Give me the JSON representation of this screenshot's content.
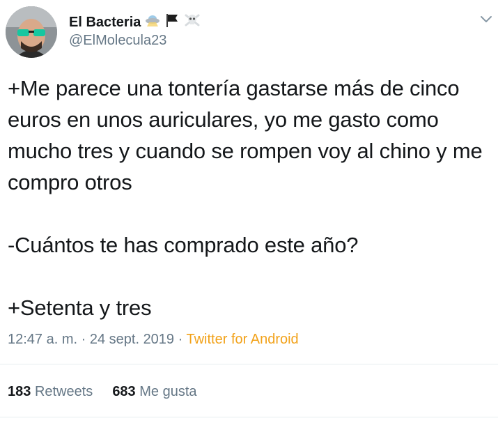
{
  "author": {
    "display_name": "El Bacteria",
    "name_emojis": [
      "ufo-emoji",
      "black-flag-emoji",
      "skull-crossbones-emoji"
    ],
    "handle": "@ElMolecula23"
  },
  "tweet": {
    "paragraphs": [
      "+Me parece una tontería gastarse más de cinco euros en unos auriculares, yo me gasto como mucho tres y cuando se rompen voy al chino y me compro otros",
      "-Cuántos te has comprado este año?",
      "+Setenta y tres"
    ]
  },
  "meta": {
    "time": "12:47 a. m.",
    "separator1": " · ",
    "date": "24 sept. 2019",
    "separator2": " · ",
    "source": "Twitter for Android"
  },
  "stats": {
    "retweets_count": "183",
    "retweets_label": "Retweets",
    "likes_count": "683",
    "likes_label": "Me gusta"
  },
  "colors": {
    "text": "#14171a",
    "secondary": "#657786",
    "source_link": "#f2a21a",
    "divider": "#e6ecf0"
  }
}
